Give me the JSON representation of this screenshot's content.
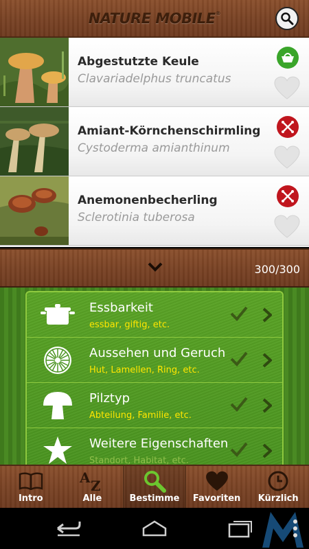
{
  "header": {
    "logo_text": "NATURE MOBILE",
    "logo_mark": "®"
  },
  "list": [
    {
      "name": "Abgestutzte Keule",
      "latin": "Clavariadelphus truncatus",
      "badge": "edible-basket-icon"
    },
    {
      "name": "Amiant-Körnchenschirmling",
      "latin": "Cystoderma amianthinum",
      "badge": "not-edible-icon"
    },
    {
      "name": "Anemonenbecherling",
      "latin": "Sclerotinia tuberosa",
      "badge": "not-edible-icon"
    }
  ],
  "counter": "300/300",
  "filters": [
    {
      "title": "Essbarkeit",
      "subtitle": "essbar, giftig, etc.",
      "icon": "pot-icon"
    },
    {
      "title": "Aussehen und Geruch",
      "subtitle": "Hut, Lamellen, Ring, etc.",
      "icon": "gills-icon"
    },
    {
      "title": "Pilztyp",
      "subtitle": "Abteilung, Familie, etc.",
      "icon": "mushroom-icon"
    },
    {
      "title": "Weitere Eigenschaften",
      "subtitle": "Standort, Habitat, etc.",
      "icon": "star-icon"
    }
  ],
  "tabs": [
    {
      "label": "Intro",
      "icon": "book-icon"
    },
    {
      "label": "Alle",
      "icon": "az-icon"
    },
    {
      "label": "Bestimme",
      "icon": "magnifier-icon",
      "active": true
    },
    {
      "label": "Favoriten",
      "icon": "heart-icon"
    },
    {
      "label": "Kürzlich",
      "icon": "clock-icon"
    }
  ],
  "colors": {
    "wood": "#7a4325",
    "green": "#4a9420",
    "yellow": "#ffe600",
    "edible": "#3aa52a",
    "inedible": "#c0161e"
  }
}
